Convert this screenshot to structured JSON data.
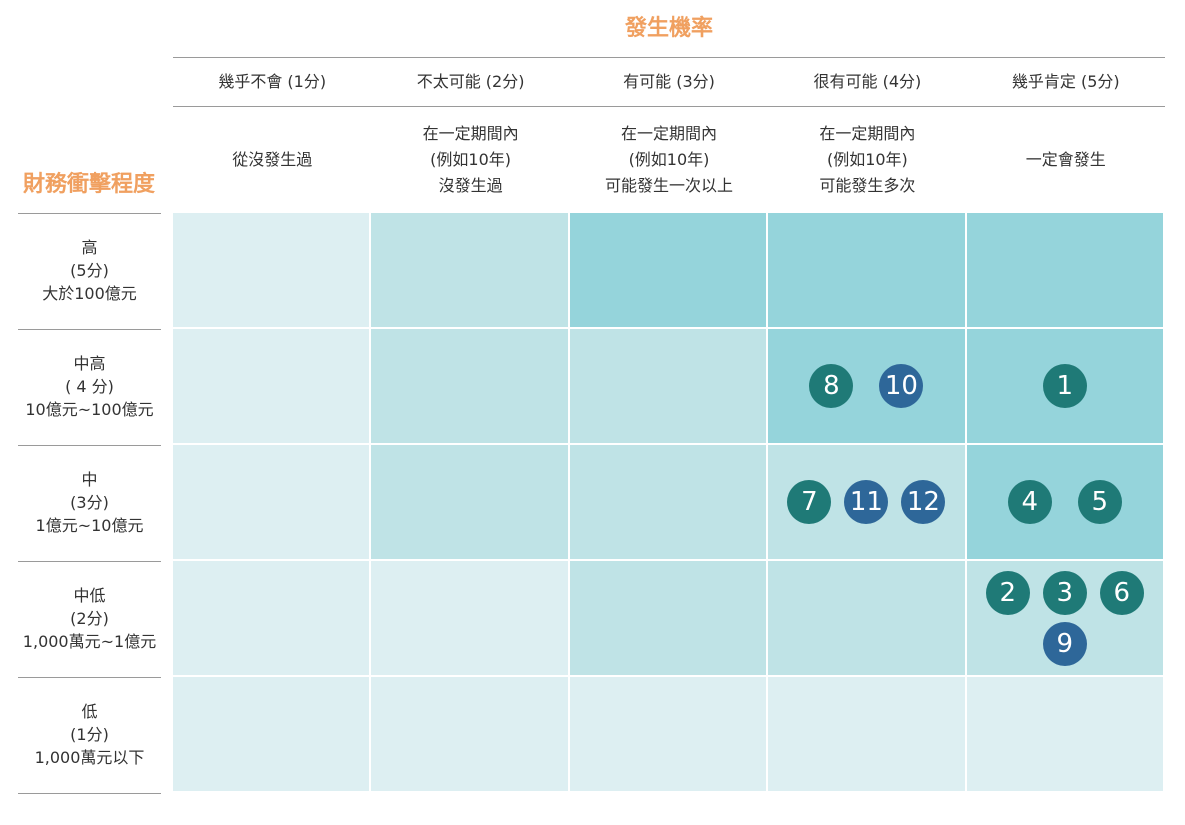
{
  "col_axis_title": "發生機率",
  "row_axis_title": "財務衝擊程度",
  "columns": [
    {
      "label": "幾乎不會 (1分)",
      "desc": [
        "從沒發生過"
      ]
    },
    {
      "label": "不太可能 (2分)",
      "desc": [
        "在一定期間內",
        "(例如10年)",
        "沒發生過"
      ]
    },
    {
      "label": "有可能 (3分)",
      "desc": [
        "在一定期間內",
        "(例如10年)",
        "可能發生一次以上"
      ]
    },
    {
      "label": "很有可能 (4分)",
      "desc": [
        "在一定期間內",
        "(例如10年)",
        "可能發生多次"
      ]
    },
    {
      "label": "幾乎肯定 (5分)",
      "desc": [
        "一定會發生"
      ]
    }
  ],
  "rows": [
    {
      "lines": [
        "高",
        "(5分)",
        "大於100億元"
      ]
    },
    {
      "lines": [
        "中高",
        "( 4 分)",
        "10億元~100億元"
      ]
    },
    {
      "lines": [
        "中",
        "(3分)",
        "1億元~10億元"
      ]
    },
    {
      "lines": [
        "中低",
        "(2分)",
        "1,000萬元~1億元"
      ]
    },
    {
      "lines": [
        "低",
        "(1分)",
        "1,000萬元以下"
      ]
    }
  ],
  "colors": {
    "level1": "#DDEFF2",
    "level2": "#BFE3E6",
    "level3": "#95D4DB",
    "teal_marker": "#1F7A77",
    "blue_marker": "#2E6799",
    "axis_title": "#F0A060"
  },
  "cell_levels": [
    [
      1,
      2,
      3,
      3,
      3
    ],
    [
      1,
      2,
      2,
      3,
      3
    ],
    [
      1,
      2,
      2,
      2,
      3
    ],
    [
      1,
      1,
      2,
      2,
      2
    ],
    [
      1,
      1,
      1,
      1,
      1
    ]
  ],
  "risks": [
    {
      "id": "1",
      "impact": 4,
      "likelihood": 5,
      "color": "teal"
    },
    {
      "id": "2",
      "impact": 2,
      "likelihood": 5,
      "color": "teal"
    },
    {
      "id": "3",
      "impact": 2,
      "likelihood": 5,
      "color": "teal"
    },
    {
      "id": "4",
      "impact": 3,
      "likelihood": 5,
      "color": "teal"
    },
    {
      "id": "5",
      "impact": 3,
      "likelihood": 5,
      "color": "teal"
    },
    {
      "id": "6",
      "impact": 2,
      "likelihood": 5,
      "color": "teal"
    },
    {
      "id": "7",
      "impact": 3,
      "likelihood": 4,
      "color": "teal"
    },
    {
      "id": "8",
      "impact": 4,
      "likelihood": 4,
      "color": "teal"
    },
    {
      "id": "9",
      "impact": 2,
      "likelihood": 5,
      "color": "blue"
    },
    {
      "id": "10",
      "impact": 4,
      "likelihood": 4,
      "color": "blue"
    },
    {
      "id": "11",
      "impact": 3,
      "likelihood": 4,
      "color": "blue"
    },
    {
      "id": "12",
      "impact": 3,
      "likelihood": 4,
      "color": "blue"
    }
  ]
}
